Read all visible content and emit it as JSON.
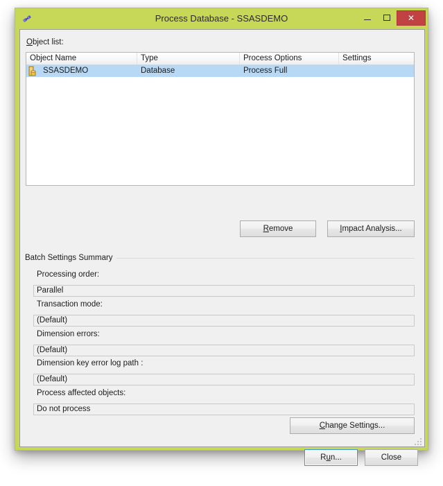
{
  "window": {
    "title": "Process Database - SSASDEMO",
    "icon": "process-database-icon",
    "border_color": "#c7d758",
    "minimize_label": "",
    "maximize_label": "",
    "close_label": "✕"
  },
  "object_list": {
    "label_accel": "O",
    "label_rest": "bject list:",
    "columns": [
      "Object Name",
      "Type",
      "Process Options",
      "Settings"
    ],
    "rows": [
      {
        "icon": "database-icon",
        "object_name": "SSASDEMO",
        "type": "Database",
        "process_options": "Process Full",
        "settings": "",
        "selected": true
      }
    ]
  },
  "list_buttons": {
    "remove": {
      "accel": "R",
      "rest": "emove"
    },
    "impact_analysis": {
      "accel": "I",
      "rest": "mpact Analysis..."
    }
  },
  "batch_settings": {
    "group_title": "Batch Settings Summary",
    "fields": [
      {
        "label": "Processing order:",
        "value": "Parallel"
      },
      {
        "label": "Transaction mode:",
        "value": "(Default)"
      },
      {
        "label": "Dimension errors:",
        "value": "(Default)"
      },
      {
        "label": "Dimension key error log path :",
        "value": "(Default)"
      },
      {
        "label": "Process affected objects:",
        "value": "Do not process"
      }
    ]
  },
  "change_settings_button": {
    "accel": "C",
    "rest": "hange Settings..."
  },
  "dialog_buttons": {
    "run": {
      "pre": "R",
      "accel": "u",
      "rest": "n...",
      "focused": true
    },
    "close": {
      "label": "Close"
    }
  },
  "colors": {
    "title_bar": "#c7d758",
    "close_button": "#c14242",
    "selection": "#b8d9f5",
    "dialog_background": "#f0f0f0",
    "focus_border": "#3c97d8"
  }
}
